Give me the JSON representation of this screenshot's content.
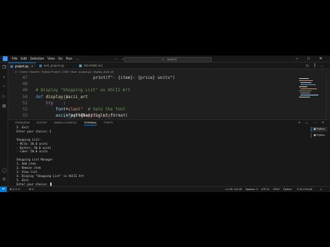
{
  "menu": [
    "File",
    "Edit",
    "Selection",
    "View",
    "Go",
    "Run",
    "…"
  ],
  "search": {
    "label": "Search",
    "icon": "search-icon"
  },
  "window_controls": [
    "–",
    "□",
    "✕"
  ],
  "tabs": [
    {
      "label": "project.py",
      "active": true,
      "color": "#3572a5"
    },
    {
      "label": "test_project.py",
      "active": false,
      "color": "#3572a5"
    },
    {
      "label": "README.md",
      "active": false,
      "color": "#519aba"
    }
  ],
  "breadcrumb": "C: › Users › Naveen › Python Project › CS50 › final › project.py › display_ascii_art",
  "editor": {
    "lines": [
      {
        "n": "47",
        "parts": [
          {
            "c": "code",
            "t": "            print(f\"- {item}: {price} units\")"
          }
        ]
      },
      {
        "n": "48",
        "parts": [
          {
            "c": "code",
            "t": ""
          }
        ]
      },
      {
        "n": "49",
        "parts": [
          {
            "c": "cmt",
            "t": "# Display \"Shopping List\" as ASCII Art"
          }
        ]
      },
      {
        "n": "50",
        "parts": [
          {
            "c": "kw",
            "t": "def "
          },
          {
            "c": "fn",
            "t": "display_ascii_art"
          },
          {
            "c": "code",
            "t": "():"
          }
        ]
      },
      {
        "n": "51",
        "parts": [
          {
            "c": "ctl",
            "t": "    try"
          },
          {
            "c": "code",
            "t": ":"
          }
        ]
      },
      {
        "n": "52",
        "parts": [
          {
            "c": "var",
            "t": "        font"
          },
          {
            "c": "code",
            "t": " = "
          },
          {
            "c": "str",
            "t": "\"slant\""
          },
          {
            "c": "cmt",
            "t": "  # Sets the font"
          }
        ]
      },
      {
        "n": "53",
        "parts": [
          {
            "c": "var",
            "t": "        ascii_art"
          },
          {
            "c": "code",
            "t": " = pyfiglet.figlet_format("
          },
          {
            "c": "str",
            "t": "\"Shopping List\""
          },
          {
            "c": "code",
            "t": ", font=font)"
          }
        ]
      }
    ]
  },
  "panel": {
    "tabs": [
      "PROBLEMS",
      "OUTPUT",
      "DEBUG CONSOLE",
      "TERMINAL",
      "PORTS"
    ],
    "active_tab": "TERMINAL",
    "terminal_lines": [
      "5. Exit",
      "Enter your choice: 3",
      "",
      "Shopping List:",
      "- Milk: 30.0 units",
      "- Butter: 50.0 units",
      "- Cake: 50.0 units",
      "",
      "Shopping List Manager",
      "1. Add item",
      "2. Remove item",
      "3. View list",
      "4. Display \"Shopping List\" in ASCII Art",
      "5. Exit",
      "Enter your choice: "
    ],
    "terminals": [
      "Python",
      "Python"
    ]
  },
  "statusbar": {
    "problems": "⊗ 0  ⚠ 0",
    "ports": "⊘ 0",
    "position": "Ln 29, Col 39",
    "spaces": "Spaces: 4",
    "encoding": "UTF-8",
    "eol": "CRLF",
    "language": "Python",
    "interpreter": "3.12.4 64-bit"
  },
  "colors": {
    "accent": "#0078d4",
    "background": "#1f1f1f",
    "panel": "#181818"
  }
}
